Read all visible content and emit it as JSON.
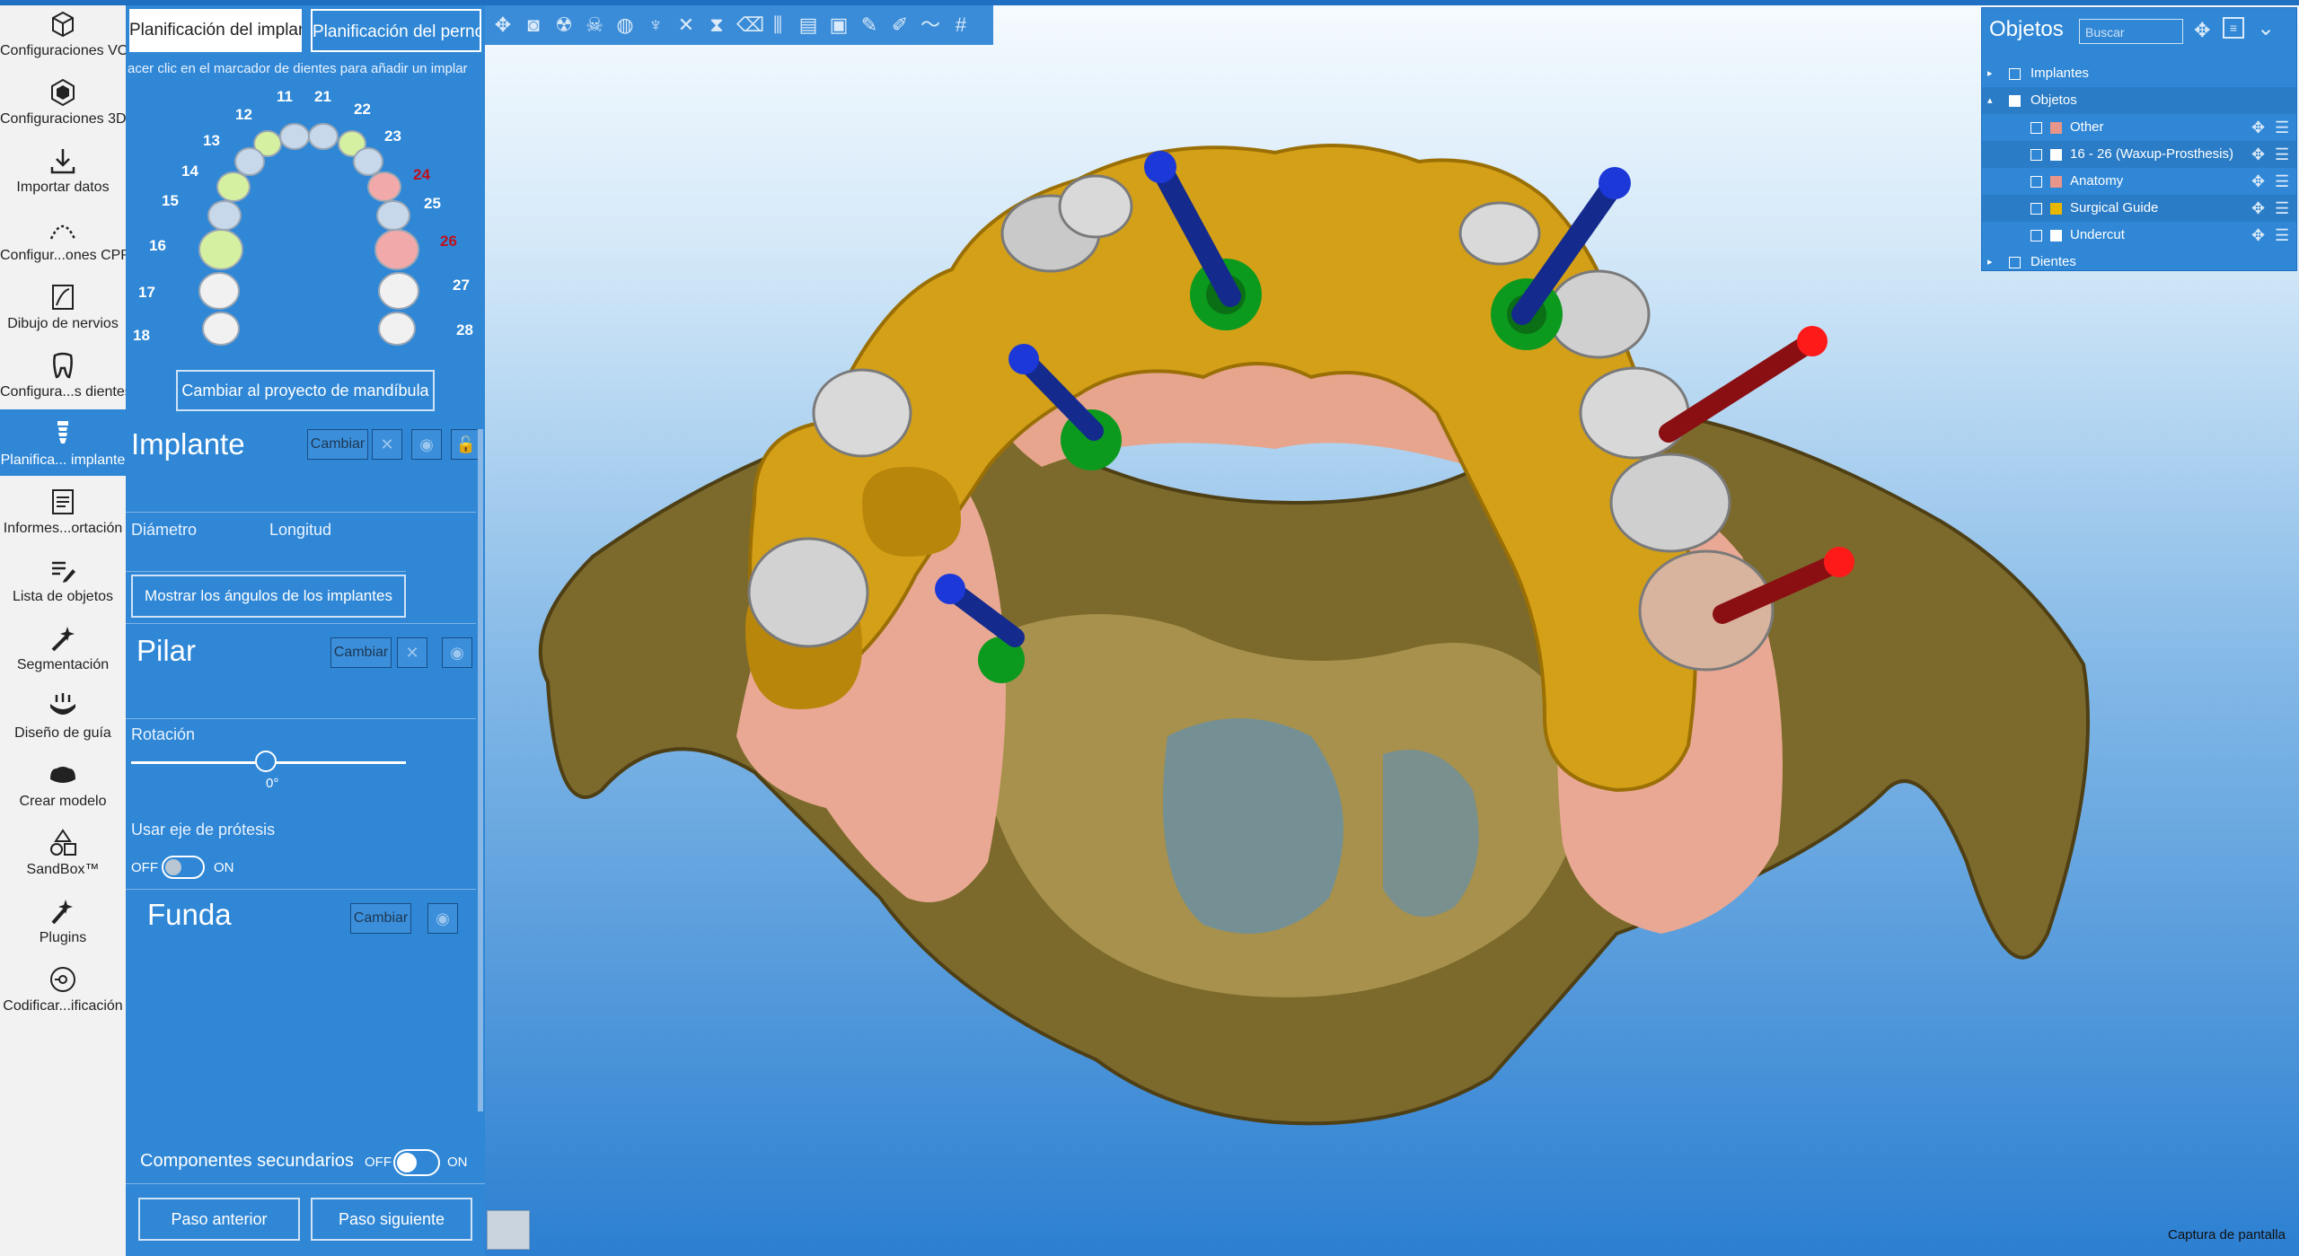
{
  "rail": {
    "items": [
      {
        "label": "Configuraciones VOI",
        "icon": "cube-outline-icon"
      },
      {
        "label": "Configuraciones 3D",
        "icon": "cube-3d-icon"
      },
      {
        "label": "Importar datos",
        "icon": "import-icon"
      },
      {
        "label": "Configur...ones CPR",
        "icon": "arc-dots-icon"
      },
      {
        "label": "Dibujo de nervios",
        "icon": "nerve-icon"
      },
      {
        "label": "Configura...s dientes",
        "icon": "tooth-icon"
      },
      {
        "label": "Planifica... implante",
        "icon": "implant-icon"
      },
      {
        "label": "Informes...ortación",
        "icon": "report-icon"
      },
      {
        "label": "Lista de objetos",
        "icon": "list-edit-icon"
      },
      {
        "label": "Segmentación",
        "icon": "magic-wand-icon"
      },
      {
        "label": "Diseño de guía",
        "icon": "guide-icon"
      },
      {
        "label": "Crear modelo",
        "icon": "model-icon"
      },
      {
        "label": "SandBox™",
        "icon": "shapes-icon"
      },
      {
        "label": "Plugins",
        "icon": "plugin-icon"
      },
      {
        "label": "Codificar...ificación",
        "icon": "code-disk-icon"
      }
    ]
  },
  "panel": {
    "tab_implant": "Planificación del implante",
    "tab_post": "Planificación del perno",
    "hint": "acer clic en el marcador de dientes para añadir un implar",
    "teeth": {
      "t11": "11",
      "t21": "21",
      "t12": "12",
      "t22": "22",
      "t13": "13",
      "t23": "23",
      "t14": "14",
      "t24": "24",
      "t15": "15",
      "t25": "25",
      "t16": "16",
      "t26": "26",
      "t17": "17",
      "t27": "27",
      "t18": "18",
      "t28": "28"
    },
    "switch_mandible": "Cambiar al proyecto de mandíbula",
    "implant": {
      "title": "Implante",
      "change": "Cambiar",
      "diameter_label": "Diámetro",
      "length_label": "Longitud",
      "show_angles": "Mostrar los ángulos de los implantes"
    },
    "abutment": {
      "title": "Pilar",
      "change": "Cambiar",
      "rotation_label": "Rotación",
      "rotation_value": "0°",
      "use_axis_label": "Usar eje de prótesis",
      "off": "OFF",
      "on": "ON"
    },
    "crown": {
      "title": "Funda",
      "change": "Cambiar"
    },
    "secondary": {
      "label": "Componentes secundarios",
      "off": "OFF",
      "on": "ON"
    },
    "prev": "Paso anterior",
    "next": "Paso siguiente"
  },
  "objects": {
    "title": "Objetos",
    "search_placeholder": "Buscar",
    "rows": [
      {
        "label": "Implantes",
        "color": ""
      },
      {
        "label": "Objetos",
        "color": ""
      },
      {
        "label": "Other",
        "color": "#e8958a"
      },
      {
        "label": "16 - 26 (Waxup-Prosthesis)",
        "color": "#ffffff"
      },
      {
        "label": "Anatomy",
        "color": "#e8958a"
      },
      {
        "label": "Surgical Guide",
        "color": "#e8b800"
      },
      {
        "label": "Undercut",
        "color": "#ffffff"
      },
      {
        "label": "Dientes",
        "color": ""
      }
    ]
  },
  "viewport": {
    "capture": "Captura de pantalla"
  },
  "colors": {
    "panel_blue": "#2f87d6",
    "guide_gold": "#d4a017",
    "bone": "#8a7a3a",
    "gum": "#f0b4a0",
    "implant_blue": "#142a8c",
    "implant_red": "#8a0f12",
    "ring_green": "#0c9a1e"
  }
}
